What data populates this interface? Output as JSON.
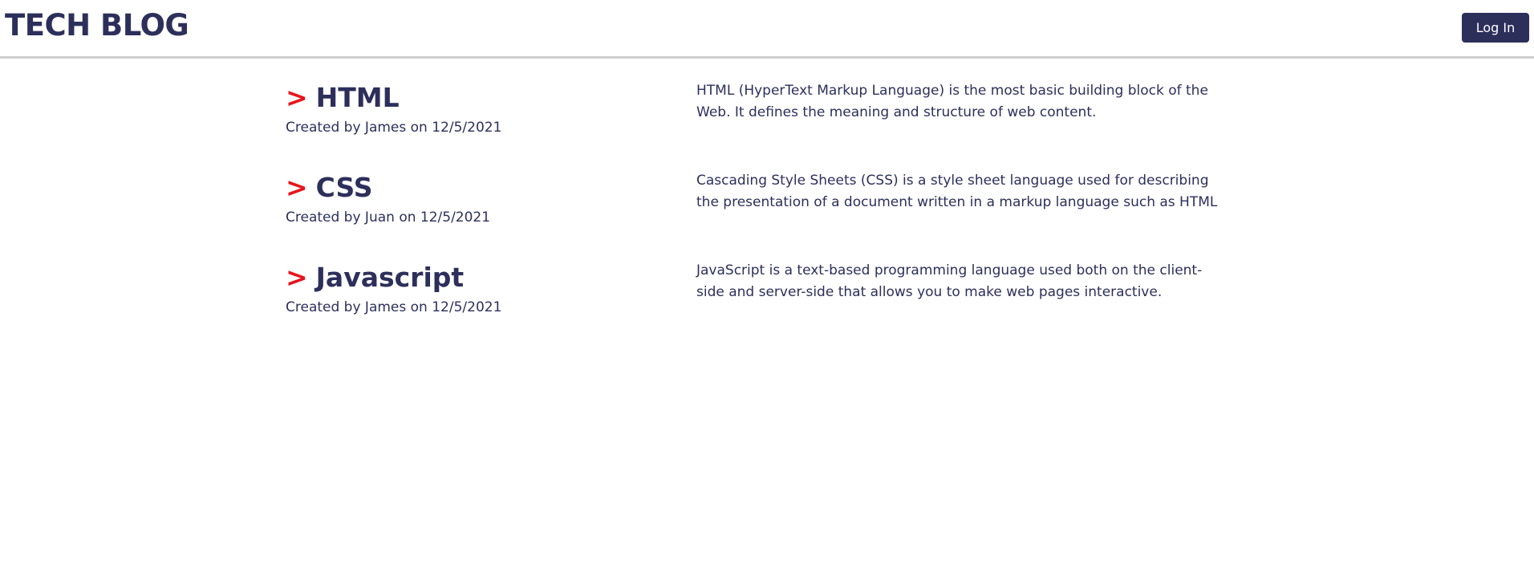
{
  "header": {
    "brand": "TECH BLOG",
    "login_label": "Log In"
  },
  "colors": {
    "primary": "#2d2f5b",
    "accent": "#e8141c",
    "divider": "#cfcfcf"
  },
  "posts": [
    {
      "chevron": ">",
      "title": "HTML",
      "meta": "Created by James on 12/5/2021",
      "description": "HTML (HyperText Markup Language) is the most basic building block of the Web. It defines the meaning and structure of web content."
    },
    {
      "chevron": ">",
      "title": "CSS",
      "meta": "Created by Juan on 12/5/2021",
      "description": "Cascading Style Sheets (CSS) is a style sheet language used for describing the presentation of a document written in a markup language such as HTML"
    },
    {
      "chevron": ">",
      "title": "Javascript",
      "meta": "Created by James on 12/5/2021",
      "description": "JavaScript is a text-based programming language used both on the client-side and server-side that allows you to make web pages interactive."
    }
  ]
}
